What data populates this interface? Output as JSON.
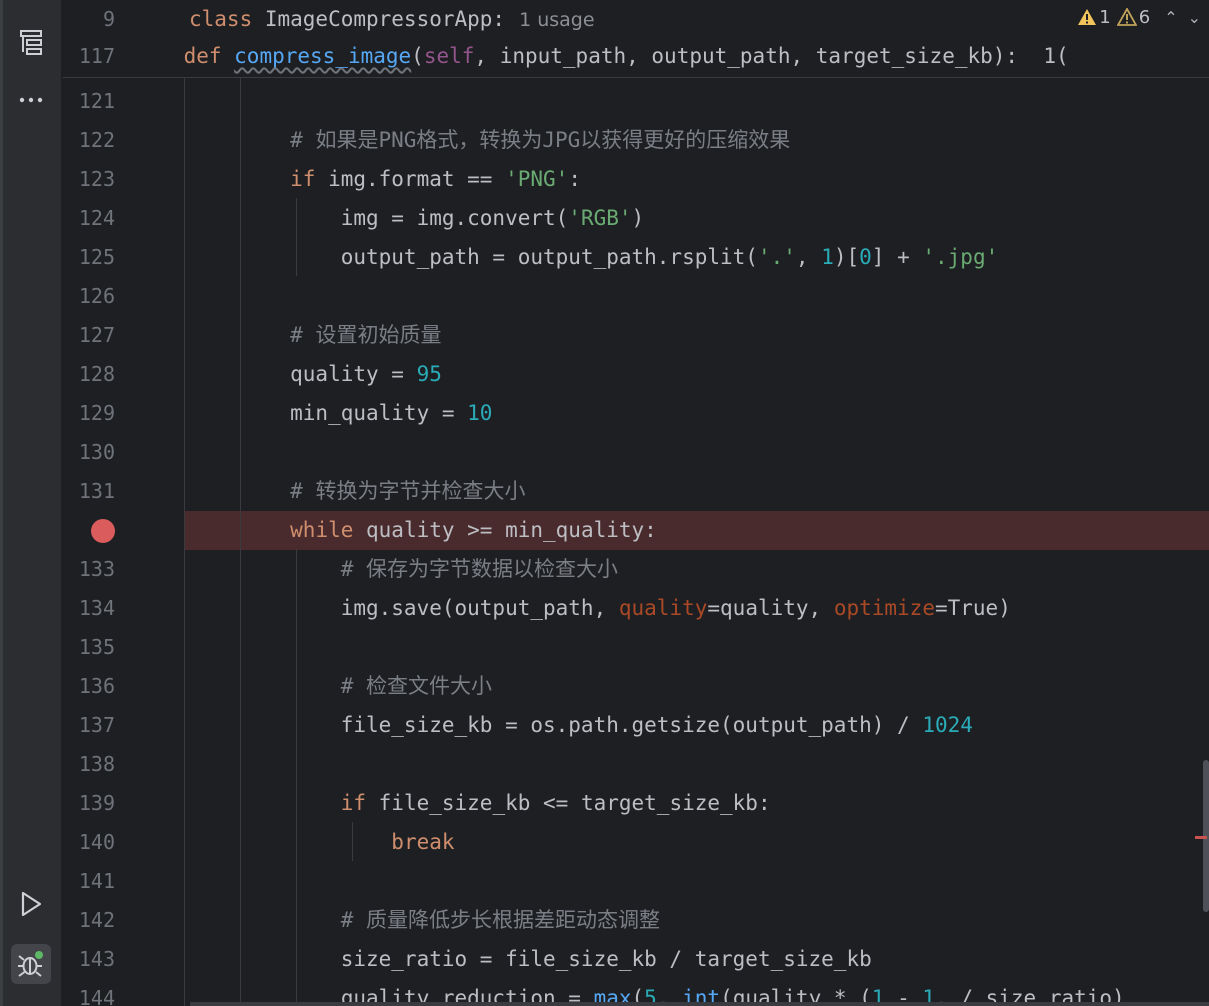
{
  "toolstrip": {
    "top_icons": [
      "structure-icon",
      "more-icon"
    ],
    "bottom_icons": [
      "run-icon",
      "debug-icon"
    ]
  },
  "sticky": {
    "lines": [
      {
        "number": "9",
        "tokens": [
          [
            "kw",
            "class "
          ],
          [
            "",
            "ImageCompressorApp:"
          ]
        ],
        "usage": "1 usage"
      },
      {
        "number": "117",
        "tokens": [
          [
            "",
            "    "
          ],
          [
            "kw",
            "def "
          ],
          [
            "fnu",
            "compress_image"
          ],
          [
            "",
            "("
          ],
          [
            "self",
            "self"
          ],
          [
            "",
            ", input_path, output_path, target_size_kb):  1("
          ]
        ]
      }
    ],
    "inspections": {
      "warning_count": "1",
      "weak_warning_count": "6"
    }
  },
  "editor": {
    "lines": [
      {
        "number": "121",
        "tokens": []
      },
      {
        "number": "122",
        "tokens": [
          [
            "",
            "        "
          ],
          [
            "cmt",
            "# 如果是PNG格式，转换为JPG以获得更好的压缩效果"
          ]
        ]
      },
      {
        "number": "123",
        "tokens": [
          [
            "",
            "        "
          ],
          [
            "kw",
            "if "
          ],
          [
            "",
            "img.format == "
          ],
          [
            "str",
            "'PNG'"
          ],
          [
            "",
            ":"
          ]
        ]
      },
      {
        "number": "124",
        "tokens": [
          [
            "",
            "            img = img.convert("
          ],
          [
            "str",
            "'RGB'"
          ],
          [
            "",
            ")"
          ]
        ]
      },
      {
        "number": "125",
        "tokens": [
          [
            "",
            "            output_path = output_path.rsplit("
          ],
          [
            "str",
            "'.'"
          ],
          [
            "",
            ", "
          ],
          [
            "num",
            "1"
          ],
          [
            "",
            ")["
          ],
          [
            "num",
            "0"
          ],
          [
            "",
            "] + "
          ],
          [
            "str",
            "'.jpg'"
          ]
        ]
      },
      {
        "number": "126",
        "tokens": []
      },
      {
        "number": "127",
        "tokens": [
          [
            "",
            "        "
          ],
          [
            "cmt",
            "# 设置初始质量"
          ]
        ]
      },
      {
        "number": "128",
        "tokens": [
          [
            "",
            "        quality = "
          ],
          [
            "num",
            "95"
          ]
        ]
      },
      {
        "number": "129",
        "tokens": [
          [
            "",
            "        min_quality = "
          ],
          [
            "num",
            "10"
          ]
        ]
      },
      {
        "number": "130",
        "tokens": []
      },
      {
        "number": "131",
        "tokens": [
          [
            "",
            "        "
          ],
          [
            "cmt",
            "# 转换为字节并检查大小"
          ]
        ]
      },
      {
        "number": "",
        "breakpoint": true,
        "tokens": [
          [
            "",
            "        "
          ],
          [
            "kw",
            "while "
          ],
          [
            "",
            "quality >= min_quality:"
          ]
        ]
      },
      {
        "number": "133",
        "tokens": [
          [
            "",
            "            "
          ],
          [
            "cmt",
            "# 保存为字节数据以检查大小"
          ]
        ]
      },
      {
        "number": "134",
        "tokens": [
          [
            "",
            "            img.save(output_path, "
          ],
          [
            "param",
            "quality"
          ],
          [
            "",
            "=quality, "
          ],
          [
            "param",
            "optimize"
          ],
          [
            "",
            "=True)"
          ]
        ]
      },
      {
        "number": "135",
        "tokens": []
      },
      {
        "number": "136",
        "tokens": [
          [
            "",
            "            "
          ],
          [
            "cmt",
            "# 检查文件大小"
          ]
        ]
      },
      {
        "number": "137",
        "tokens": [
          [
            "",
            "            file_size_kb = os.path.getsize(output_path) / "
          ],
          [
            "num",
            "1024"
          ]
        ]
      },
      {
        "number": "138",
        "tokens": []
      },
      {
        "number": "139",
        "tokens": [
          [
            "",
            "            "
          ],
          [
            "kw",
            "if "
          ],
          [
            "",
            "file_size_kb <= target_size_kb:"
          ]
        ]
      },
      {
        "number": "140",
        "tokens": [
          [
            "",
            "                "
          ],
          [
            "kw",
            "break"
          ]
        ]
      },
      {
        "number": "141",
        "tokens": []
      },
      {
        "number": "142",
        "tokens": [
          [
            "",
            "            "
          ],
          [
            "cmt",
            "# 质量降低步长根据差距动态调整"
          ]
        ]
      },
      {
        "number": "143",
        "tokens": [
          [
            "",
            "            size_ratio = file_size_kb / target_size_kb"
          ]
        ]
      },
      {
        "number": "144",
        "tokens": [
          [
            "",
            "            quality_reduction = "
          ],
          [
            "fn",
            "max"
          ],
          [
            "",
            "("
          ],
          [
            "num",
            "5"
          ],
          [
            "",
            ", "
          ],
          [
            "fn",
            "int"
          ],
          [
            "",
            "(quality * ("
          ],
          [
            "num",
            "1"
          ],
          [
            "",
            " - "
          ],
          [
            "num",
            "1"
          ],
          [
            "",
            ", / size_ratio)"
          ]
        ]
      }
    ]
  },
  "colors": {
    "background": "#1e1f22",
    "keyword": "#cf8e6d",
    "function": "#56a8f5",
    "string": "#6aab73",
    "number": "#2aacb8",
    "comment": "#7a7e85",
    "breakpoint": "#db5c5c",
    "breakpoint_line": "#4a2b2d"
  }
}
